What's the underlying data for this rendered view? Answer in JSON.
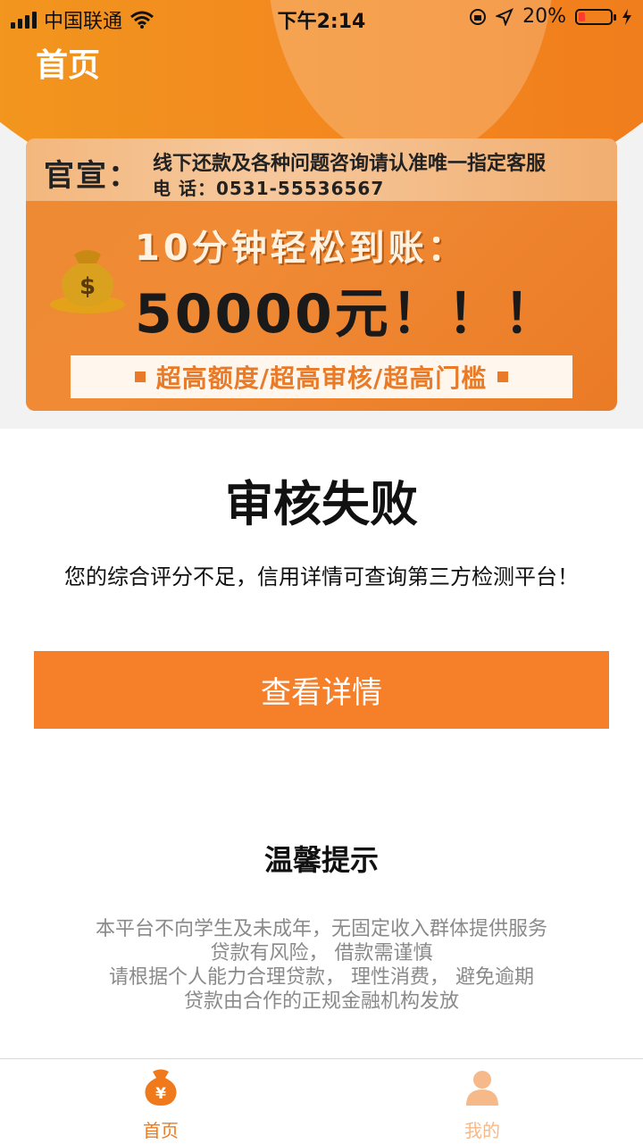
{
  "status_bar": {
    "carrier": "中国联通",
    "time": "下午2:14",
    "battery_text": "20%",
    "battery_level": 0.2
  },
  "header": {
    "title": "首页"
  },
  "banner": {
    "tag": "官宣：",
    "notice": "线下还款及各种问题咨询请认准唯一指定客服",
    "phone": "电 话：0531-55536567",
    "line1": "10分钟轻松到账：",
    "line2": "50000元！！！",
    "strip": "超高额度/超高审核/超高门槛"
  },
  "result": {
    "title": "审核失败",
    "description": "您的综合评分不足，信用详情可查询第三方检测平台！",
    "button_label": "查看详情"
  },
  "tips": {
    "title": "温馨提示",
    "lines": [
      "本平台不向学生及未成年，无固定收入群体提供服务",
      "贷款有风险， 借款需谨慎",
      "请根据个人能力合理贷款， 理性消费， 避免逾期",
      "贷款由合作的正规金融机构发放"
    ]
  },
  "tabbar": {
    "items": [
      {
        "label": "首页",
        "icon": "money-bag-icon",
        "active": true
      },
      {
        "label": "我的",
        "icon": "user-icon",
        "active": false
      }
    ]
  },
  "colors": {
    "accent": "#f67f2a",
    "header_orange": "#f28c1f",
    "tab_active": "#f07a1b",
    "tab_inactive": "#f6b98a"
  }
}
